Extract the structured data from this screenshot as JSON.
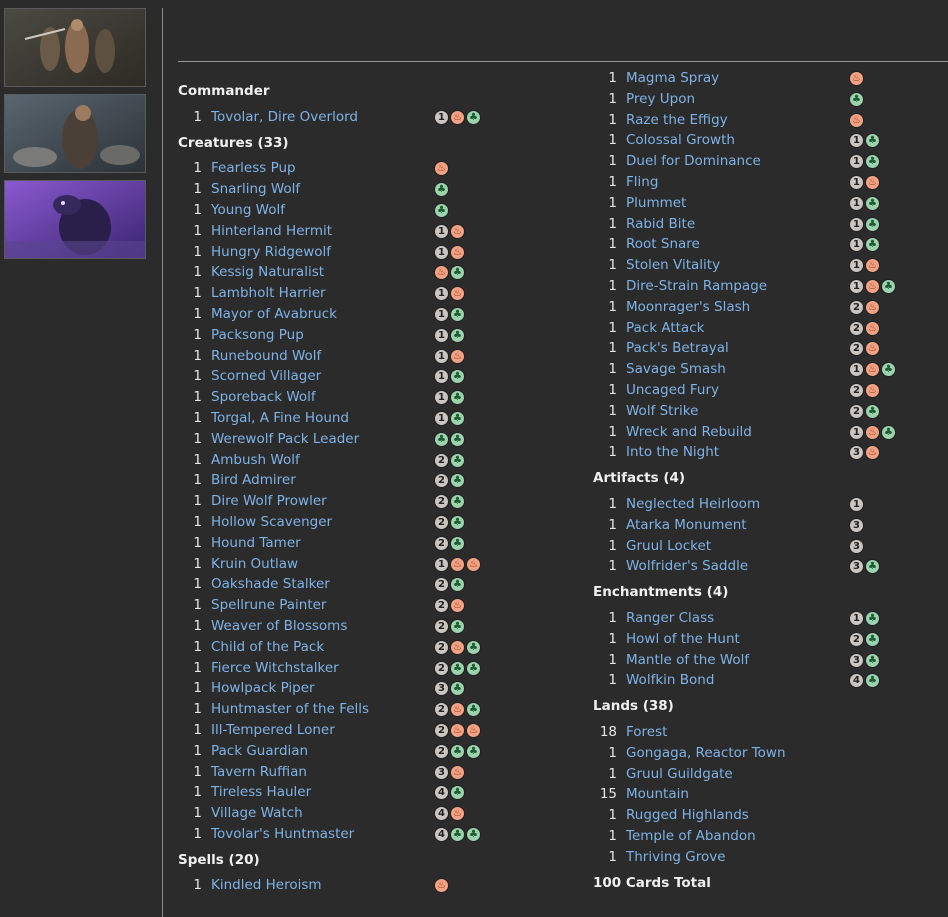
{
  "sidebar": {
    "thumbnails": [
      "card-art-1",
      "card-art-2",
      "card-art-3"
    ]
  },
  "colors": {
    "link": "#7fb2e6",
    "background": "#2b2b2b",
    "green_mana": "#9bd3ae",
    "red_mana": "#f3a383",
    "generic_mana": "#cac5c0"
  },
  "left_sections": [
    {
      "title": "Commander",
      "cards": [
        {
          "qty": "1",
          "name": "Tovolar, Dire Overlord",
          "cost": [
            "1",
            "R",
            "G"
          ]
        }
      ]
    },
    {
      "title": "Creatures (33)",
      "cards": [
        {
          "qty": "1",
          "name": "Fearless Pup",
          "cost": [
            "R"
          ]
        },
        {
          "qty": "1",
          "name": "Snarling Wolf",
          "cost": [
            "G"
          ]
        },
        {
          "qty": "1",
          "name": "Young Wolf",
          "cost": [
            "G"
          ]
        },
        {
          "qty": "1",
          "name": "Hinterland Hermit",
          "cost": [
            "1",
            "R"
          ]
        },
        {
          "qty": "1",
          "name": "Hungry Ridgewolf",
          "cost": [
            "1",
            "R"
          ]
        },
        {
          "qty": "1",
          "name": "Kessig Naturalist",
          "cost": [
            "R",
            "G"
          ]
        },
        {
          "qty": "1",
          "name": "Lambholt Harrier",
          "cost": [
            "1",
            "R"
          ]
        },
        {
          "qty": "1",
          "name": "Mayor of Avabruck",
          "cost": [
            "1",
            "G"
          ]
        },
        {
          "qty": "1",
          "name": "Packsong Pup",
          "cost": [
            "1",
            "G"
          ]
        },
        {
          "qty": "1",
          "name": "Runebound Wolf",
          "cost": [
            "1",
            "R"
          ]
        },
        {
          "qty": "1",
          "name": "Scorned Villager",
          "cost": [
            "1",
            "G"
          ]
        },
        {
          "qty": "1",
          "name": "Sporeback Wolf",
          "cost": [
            "1",
            "G"
          ]
        },
        {
          "qty": "1",
          "name": "Torgal, A Fine Hound",
          "cost": [
            "1",
            "G"
          ]
        },
        {
          "qty": "1",
          "name": "Werewolf Pack Leader",
          "cost": [
            "G",
            "G"
          ]
        },
        {
          "qty": "1",
          "name": "Ambush Wolf",
          "cost": [
            "2",
            "G"
          ]
        },
        {
          "qty": "1",
          "name": "Bird Admirer",
          "cost": [
            "2",
            "G"
          ]
        },
        {
          "qty": "1",
          "name": "Dire Wolf Prowler",
          "cost": [
            "2",
            "G"
          ]
        },
        {
          "qty": "1",
          "name": "Hollow Scavenger",
          "cost": [
            "2",
            "G"
          ]
        },
        {
          "qty": "1",
          "name": "Hound Tamer",
          "cost": [
            "2",
            "G"
          ]
        },
        {
          "qty": "1",
          "name": "Kruin Outlaw",
          "cost": [
            "1",
            "R",
            "R"
          ]
        },
        {
          "qty": "1",
          "name": "Oakshade Stalker",
          "cost": [
            "2",
            "G"
          ]
        },
        {
          "qty": "1",
          "name": "Spellrune Painter",
          "cost": [
            "2",
            "R"
          ]
        },
        {
          "qty": "1",
          "name": "Weaver of Blossoms",
          "cost": [
            "2",
            "G"
          ]
        },
        {
          "qty": "1",
          "name": "Child of the Pack",
          "cost": [
            "2",
            "R",
            "G"
          ]
        },
        {
          "qty": "1",
          "name": "Fierce Witchstalker",
          "cost": [
            "2",
            "G",
            "G"
          ]
        },
        {
          "qty": "1",
          "name": "Howlpack Piper",
          "cost": [
            "3",
            "G"
          ]
        },
        {
          "qty": "1",
          "name": "Huntmaster of the Fells",
          "cost": [
            "2",
            "R",
            "G"
          ]
        },
        {
          "qty": "1",
          "name": "Ill-Tempered Loner",
          "cost": [
            "2",
            "R",
            "R"
          ]
        },
        {
          "qty": "1",
          "name": "Pack Guardian",
          "cost": [
            "2",
            "G",
            "G"
          ]
        },
        {
          "qty": "1",
          "name": "Tavern Ruffian",
          "cost": [
            "3",
            "R"
          ]
        },
        {
          "qty": "1",
          "name": "Tireless Hauler",
          "cost": [
            "4",
            "G"
          ]
        },
        {
          "qty": "1",
          "name": "Village Watch",
          "cost": [
            "4",
            "R"
          ]
        },
        {
          "qty": "1",
          "name": "Tovolar's Huntmaster",
          "cost": [
            "4",
            "G",
            "G"
          ]
        }
      ]
    },
    {
      "title": "Spells (20)",
      "cards": [
        {
          "qty": "1",
          "name": "Kindled Heroism",
          "cost": [
            "R"
          ]
        }
      ]
    }
  ],
  "right_sections": [
    {
      "title": "",
      "cards": [
        {
          "qty": "1",
          "name": "Magma Spray",
          "cost": [
            "R"
          ]
        },
        {
          "qty": "1",
          "name": "Prey Upon",
          "cost": [
            "G"
          ]
        },
        {
          "qty": "1",
          "name": "Raze the Effigy",
          "cost": [
            "R"
          ]
        },
        {
          "qty": "1",
          "name": "Colossal Growth",
          "cost": [
            "1",
            "G"
          ]
        },
        {
          "qty": "1",
          "name": "Duel for Dominance",
          "cost": [
            "1",
            "G"
          ]
        },
        {
          "qty": "1",
          "name": "Fling",
          "cost": [
            "1",
            "R"
          ]
        },
        {
          "qty": "1",
          "name": "Plummet",
          "cost": [
            "1",
            "G"
          ]
        },
        {
          "qty": "1",
          "name": "Rabid Bite",
          "cost": [
            "1",
            "G"
          ]
        },
        {
          "qty": "1",
          "name": "Root Snare",
          "cost": [
            "1",
            "G"
          ]
        },
        {
          "qty": "1",
          "name": "Stolen Vitality",
          "cost": [
            "1",
            "R"
          ]
        },
        {
          "qty": "1",
          "name": "Dire-Strain Rampage",
          "cost": [
            "1",
            "R",
            "G"
          ]
        },
        {
          "qty": "1",
          "name": "Moonrager's Slash",
          "cost": [
            "2",
            "R"
          ]
        },
        {
          "qty": "1",
          "name": "Pack Attack",
          "cost": [
            "2",
            "R"
          ]
        },
        {
          "qty": "1",
          "name": "Pack's Betrayal",
          "cost": [
            "2",
            "R"
          ]
        },
        {
          "qty": "1",
          "name": "Savage Smash",
          "cost": [
            "1",
            "R",
            "G"
          ]
        },
        {
          "qty": "1",
          "name": "Uncaged Fury",
          "cost": [
            "2",
            "R"
          ]
        },
        {
          "qty": "1",
          "name": "Wolf Strike",
          "cost": [
            "2",
            "G"
          ]
        },
        {
          "qty": "1",
          "name": "Wreck and Rebuild",
          "cost": [
            "1",
            "R",
            "G"
          ]
        },
        {
          "qty": "1",
          "name": "Into the Night",
          "cost": [
            "3",
            "R"
          ]
        }
      ]
    },
    {
      "title": "Artifacts (4)",
      "cards": [
        {
          "qty": "1",
          "name": "Neglected Heirloom",
          "cost": [
            "1"
          ]
        },
        {
          "qty": "1",
          "name": "Atarka Monument",
          "cost": [
            "3"
          ]
        },
        {
          "qty": "1",
          "name": "Gruul Locket",
          "cost": [
            "3"
          ]
        },
        {
          "qty": "1",
          "name": "Wolfrider's Saddle",
          "cost": [
            "3",
            "G"
          ]
        }
      ]
    },
    {
      "title": "Enchantments (4)",
      "cards": [
        {
          "qty": "1",
          "name": "Ranger Class",
          "cost": [
            "1",
            "G"
          ]
        },
        {
          "qty": "1",
          "name": "Howl of the Hunt",
          "cost": [
            "2",
            "G"
          ]
        },
        {
          "qty": "1",
          "name": "Mantle of the Wolf",
          "cost": [
            "3",
            "G"
          ]
        },
        {
          "qty": "1",
          "name": "Wolfkin Bond",
          "cost": [
            "4",
            "G"
          ]
        }
      ]
    },
    {
      "title": "Lands (38)",
      "cards": [
        {
          "qty": "18",
          "name": "Forest",
          "cost": []
        },
        {
          "qty": "1",
          "name": "Gongaga, Reactor Town",
          "cost": []
        },
        {
          "qty": "1",
          "name": "Gruul Guildgate",
          "cost": []
        },
        {
          "qty": "15",
          "name": "Mountain",
          "cost": []
        },
        {
          "qty": "1",
          "name": "Rugged Highlands",
          "cost": []
        },
        {
          "qty": "1",
          "name": "Temple of Abandon",
          "cost": []
        },
        {
          "qty": "1",
          "name": "Thriving Grove",
          "cost": []
        }
      ]
    }
  ],
  "total": "100 Cards Total"
}
